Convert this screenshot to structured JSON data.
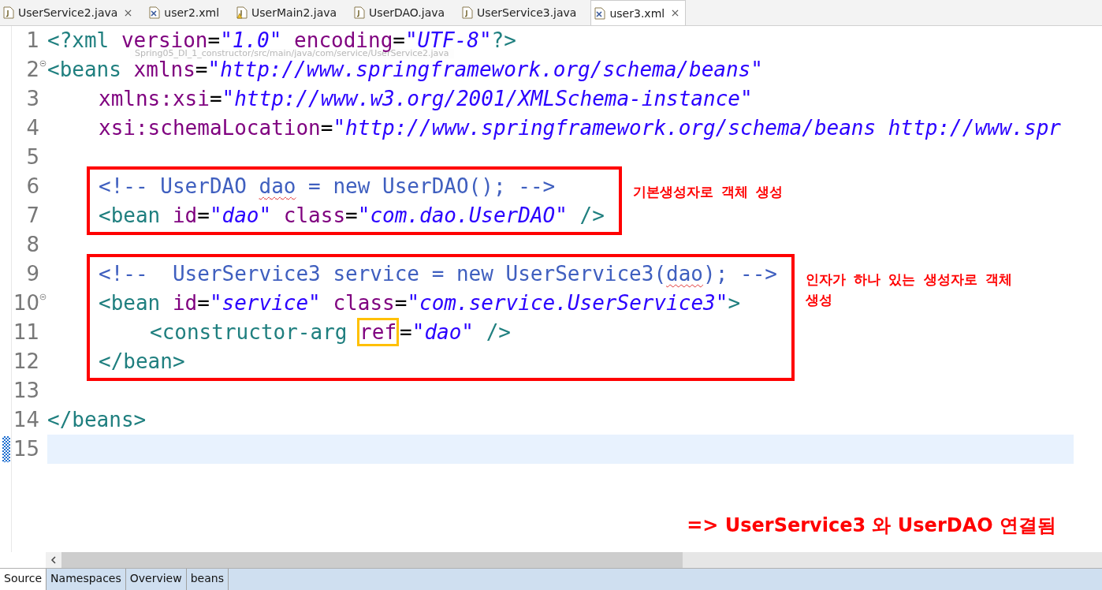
{
  "tabs": [
    {
      "label": "UserService2.java",
      "kind": "java",
      "warning": false,
      "selected": false,
      "closable": true
    },
    {
      "label": "user2.xml",
      "kind": "xml",
      "warning": false,
      "selected": false,
      "closable": false
    },
    {
      "label": "UserMain2.java",
      "kind": "java",
      "warning": true,
      "selected": false,
      "closable": false
    },
    {
      "label": "UserDAO.java",
      "kind": "java",
      "warning": false,
      "selected": false,
      "closable": false
    },
    {
      "label": "UserService3.java",
      "kind": "java",
      "warning": false,
      "selected": false,
      "closable": false
    },
    {
      "label": "user3.xml",
      "kind": "xml",
      "warning": false,
      "selected": true,
      "closable": true
    }
  ],
  "tooltip": "Spring05_DI_1_constructor/src/main/java/com/service/UserService2.java",
  "code": [
    {
      "kind": "plain",
      "lines": [
        {
          "number": "1",
          "kind": "top",
          "foldable": false,
          "current": false,
          "tokens": [
            {
              "kind": "tag",
              "text": "<?xml "
            },
            {
              "kind": "attr",
              "text": "version"
            },
            {
              "kind": "punct",
              "text": "="
            },
            {
              "kind": "string",
              "text": "\"1.0\" "
            },
            {
              "kind": "attr",
              "text": "encoding"
            },
            {
              "kind": "punct",
              "text": "="
            },
            {
              "kind": "string",
              "text": "\"UTF-8\""
            },
            {
              "kind": "tag",
              "text": "?>"
            }
          ]
        },
        {
          "number": "2",
          "kind": "top",
          "foldable": true,
          "current": false,
          "tokens": [
            {
              "kind": "tag",
              "text": "<beans "
            },
            {
              "kind": "attr",
              "text": "xmlns"
            },
            {
              "kind": "punct",
              "text": "="
            },
            {
              "kind": "string",
              "text": "\"http://www.springframework.org/schema/beans\""
            }
          ]
        },
        {
          "number": "3",
          "kind": "nested",
          "foldable": false,
          "current": false,
          "tokens": [
            {
              "kind": "attr",
              "text": "xmlns:xsi"
            },
            {
              "kind": "punct",
              "text": "="
            },
            {
              "kind": "string",
              "text": "\"http://www.w3.org/2001/XMLSchema-instance\""
            }
          ]
        },
        {
          "number": "4",
          "kind": "nested",
          "foldable": false,
          "current": false,
          "tokens": [
            {
              "kind": "attr",
              "text": "xsi:schemaLocation"
            },
            {
              "kind": "punct",
              "text": "="
            },
            {
              "kind": "string",
              "text": "\"http://www.springframework.org/schema/beans http://www.spr"
            }
          ]
        },
        {
          "number": "5",
          "kind": "top",
          "foldable": false,
          "current": false
        }
      ]
    },
    {
      "kind": "annotated",
      "note": "기본생성자로 객체 생성",
      "lines": [
        {
          "number": "6",
          "kind": "nested",
          "foldable": false,
          "current": false,
          "tokens": [
            {
              "kind": "comment",
              "text": "<!-- UserDAO "
            },
            {
              "kind": "comment_misspelled",
              "text": "dao"
            },
            {
              "kind": "comment",
              "text": " = new UserDAO(); -->"
            }
          ]
        },
        {
          "number": "7",
          "kind": "nested",
          "foldable": false,
          "current": false,
          "tokens": [
            {
              "kind": "tag",
              "text": "<bean "
            },
            {
              "kind": "attr",
              "text": "id"
            },
            {
              "kind": "punct",
              "text": "="
            },
            {
              "kind": "string",
              "text": "\"dao\" "
            },
            {
              "kind": "attr",
              "text": "class"
            },
            {
              "kind": "punct",
              "text": "="
            },
            {
              "kind": "string",
              "text": "\"com.dao.UserDAO\""
            },
            {
              "kind": "tag",
              "text": " />"
            }
          ]
        }
      ]
    },
    {
      "kind": "plain",
      "lines": [
        {
          "number": "8",
          "kind": "top",
          "foldable": false,
          "current": false
        }
      ]
    },
    {
      "kind": "annotated",
      "note": "인자가 하나 있는 생성자로 객체 생성",
      "lines": [
        {
          "number": "9",
          "kind": "nested",
          "foldable": false,
          "current": false,
          "tokens": [
            {
              "kind": "comment",
              "text": "<!--  UserService3 service = new UserService3("
            },
            {
              "kind": "comment_misspelled",
              "text": "dao"
            },
            {
              "kind": "comment",
              "text": "); -->"
            }
          ]
        },
        {
          "number": "10",
          "kind": "nested",
          "foldable": true,
          "current": false,
          "tokens": [
            {
              "kind": "tag",
              "text": "<bean "
            },
            {
              "kind": "attr",
              "text": "id"
            },
            {
              "kind": "punct",
              "text": "="
            },
            {
              "kind": "string",
              "text": "\"service\" "
            },
            {
              "kind": "attr",
              "text": "class"
            },
            {
              "kind": "punct",
              "text": "="
            },
            {
              "kind": "string",
              "text": "\"com.service.UserService3\""
            },
            {
              "kind": "tag",
              "text": ">"
            }
          ]
        },
        {
          "number": "11",
          "kind": "nested_deep",
          "foldable": false,
          "current": false,
          "tokens": [
            {
              "kind": "tag",
              "text": "<constructor-arg "
            },
            {
              "kind": "attr_boxed",
              "text": "ref"
            },
            {
              "kind": "punct",
              "text": "="
            },
            {
              "kind": "string",
              "text": "\"dao\""
            },
            {
              "kind": "tag",
              "text": " />"
            }
          ]
        },
        {
          "number": "12",
          "kind": "nested",
          "foldable": false,
          "current": false,
          "tokens": [
            {
              "kind": "tag",
              "text": "</bean>"
            }
          ]
        }
      ]
    },
    {
      "kind": "plain",
      "lines": [
        {
          "number": "13",
          "kind": "top",
          "foldable": false,
          "current": false
        },
        {
          "number": "14",
          "kind": "top",
          "foldable": false,
          "current": false,
          "tokens": [
            {
              "kind": "tag",
              "text": "</beans>"
            }
          ]
        },
        {
          "number": "15",
          "kind": "top",
          "foldable": false,
          "current": true
        }
      ]
    }
  ],
  "conclusion": "=> UserService3 와 UserDAO 연결됨",
  "bottom_tabs": [
    {
      "label": "Source",
      "selected": true
    },
    {
      "label": "Namespaces",
      "selected": false
    },
    {
      "label": "Overview",
      "selected": false
    },
    {
      "label": "beans",
      "selected": false
    }
  ]
}
